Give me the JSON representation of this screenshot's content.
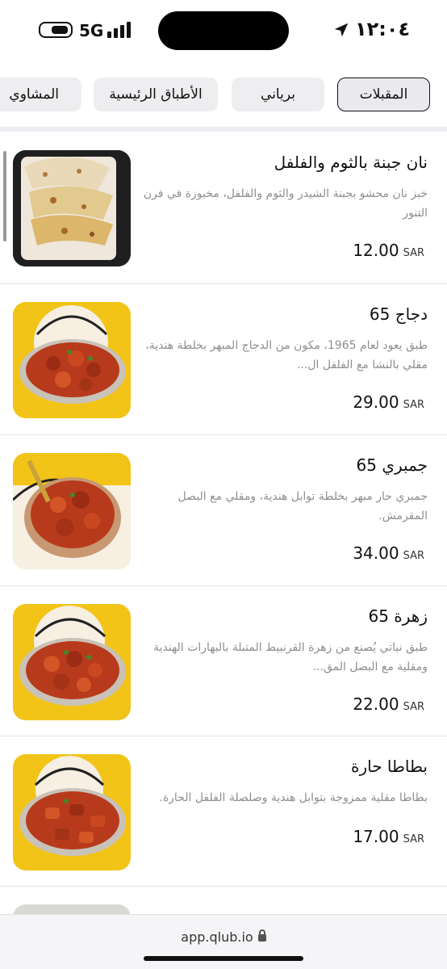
{
  "status_bar": {
    "time": "١٢:٠٤",
    "network": "5G",
    "icons": [
      "battery-icon",
      "signal-icon",
      "location-arrow-icon"
    ]
  },
  "tabs": [
    {
      "label": "المقبلات",
      "active": true
    },
    {
      "label": "برياني",
      "active": false
    },
    {
      "label": "الأطباق الرئيسية",
      "active": false
    },
    {
      "label": "المشاوي",
      "active": false
    }
  ],
  "currency": "SAR",
  "items": [
    {
      "name": "نان جبنة بالثوم والفلفل",
      "description": "خبز نان محشو بجبنة الشيدر والثوم والفلفل، مخبوزة في فرن التنور",
      "price": "12.00"
    },
    {
      "name": "دجاج 65",
      "description": "طبق يعود لعام 1965، مكون من الدجاج المبهر بخلطة هندية، مقلي بالنشا مع الفلفل ال...",
      "price": "29.00"
    },
    {
      "name": "جمبري 65",
      "description": "جمبري حار مبهر بخلطة توابل هندية، ومقلي مع البصل المقرمش.",
      "price": "34.00"
    },
    {
      "name": "زهرة 65",
      "description": "طبق نباتي يُصنع من زهرة القرنبيط المتبلة بالبهارات الهندية ومقلية مع البصل المق...",
      "price": "22.00"
    },
    {
      "name": "بطاطا حارة",
      "description": "بطاطا مقلية ممزوجة بتوابل هندية وصلصلة الفلفل الحارة.",
      "price": "17.00"
    },
    {
      "name": "",
      "description": "",
      "price": ""
    }
  ],
  "browser": {
    "url": "app.qlub.io"
  },
  "colors": {
    "tab_bg": "#eeeef1",
    "desc_text": "#8e8e93",
    "photo_yellow": "#f2c418",
    "food_red": "#b83a1c"
  }
}
